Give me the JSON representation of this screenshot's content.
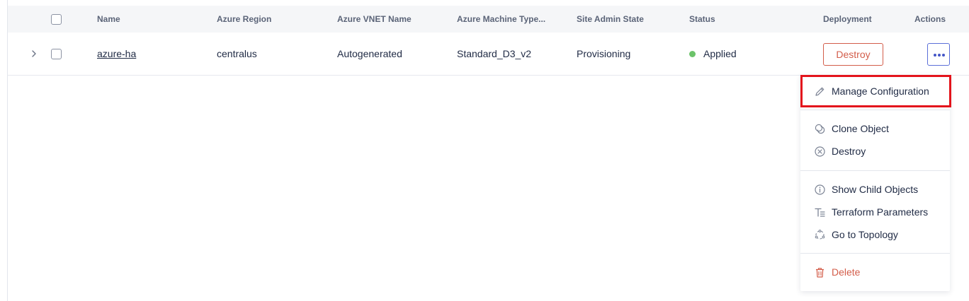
{
  "table": {
    "headers": {
      "name": "Name",
      "region": "Azure Region",
      "vnet": "Azure VNET Name",
      "machine_type": "Azure Machine Type...",
      "admin_state": "Site Admin State",
      "status": "Status",
      "deployment": "Deployment",
      "actions": "Actions"
    },
    "rows": [
      {
        "name": "azure-ha",
        "region": "centralus",
        "vnet": "Autogenerated",
        "machine_type": "Standard_D3_v2",
        "admin_state": "Provisioning",
        "status": "Applied",
        "status_color": "#6cc36a",
        "deployment_button": "Destroy"
      }
    ]
  },
  "actions_menu": {
    "items": [
      {
        "label": "Manage Configuration",
        "icon": "pencil-icon"
      },
      {
        "label": "Clone Object",
        "icon": "clone-icon"
      },
      {
        "label": "Destroy",
        "icon": "circle-x-icon"
      },
      {
        "label": "Show Child Objects",
        "icon": "info-icon"
      },
      {
        "label": "Terraform Parameters",
        "icon": "terraform-params-icon"
      },
      {
        "label": "Go to Topology",
        "icon": "topology-icon"
      },
      {
        "label": "Delete",
        "icon": "trash-icon",
        "danger": true
      }
    ],
    "highlight_color": "#e3141c"
  },
  "colors": {
    "accent": "#4456c7",
    "danger": "#d35d4a",
    "success": "#6cc36a"
  }
}
